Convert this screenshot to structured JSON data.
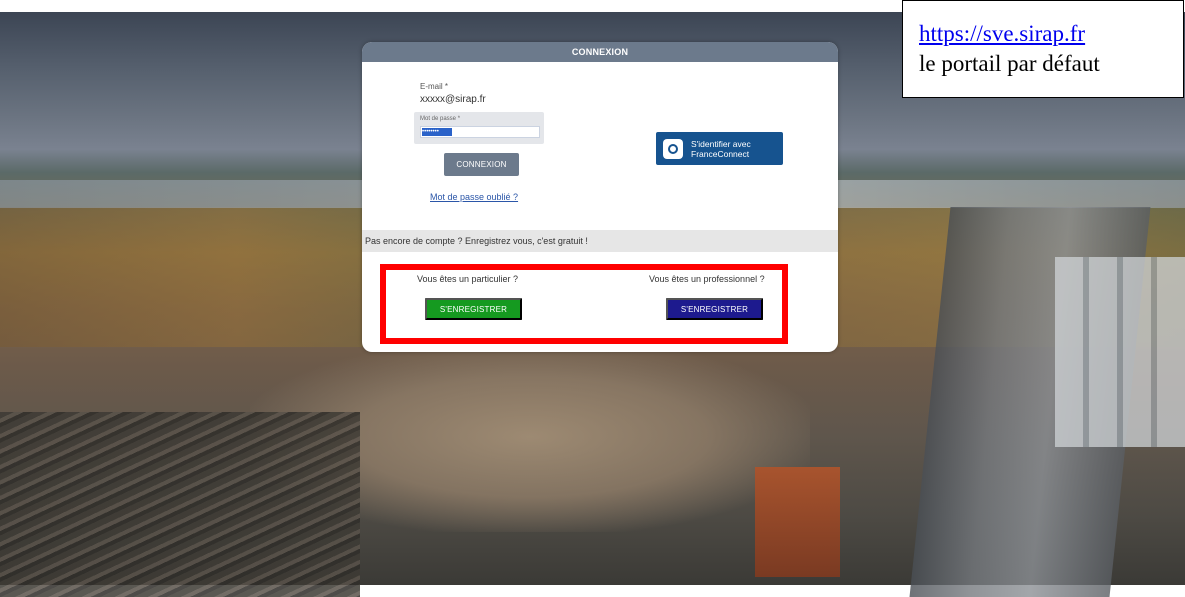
{
  "callout": {
    "url": "https://sve.sirap.fr",
    "description": "le portail par défaut"
  },
  "login": {
    "header": "CONNEXION",
    "email_label": "E-mail *",
    "email_value": "xxxxx@sirap.fr",
    "password_label": "Mot de passe *",
    "password_mask": "••••••••",
    "login_button": "CONNEXION",
    "forgot_link": "Mot de passe oublié ?",
    "franceconnect_line1": "S'identifier avec",
    "franceconnect_line2": "FranceConnect"
  },
  "register": {
    "prompt": "Pas encore de compte ? Enregistrez vous, c'est gratuit !",
    "individual_title": "Vous êtes un particulier ?",
    "individual_button": "S'ENREGISTRER",
    "professional_title": "Vous êtes un professionnel ?",
    "professional_button": "S'ENREGISTRER"
  },
  "colors": {
    "header": "#6c7a8c",
    "individual_button": "#159a20",
    "professional_button": "#1d1a8e",
    "franceconnect": "#16538f",
    "highlight": "#ff0000"
  }
}
